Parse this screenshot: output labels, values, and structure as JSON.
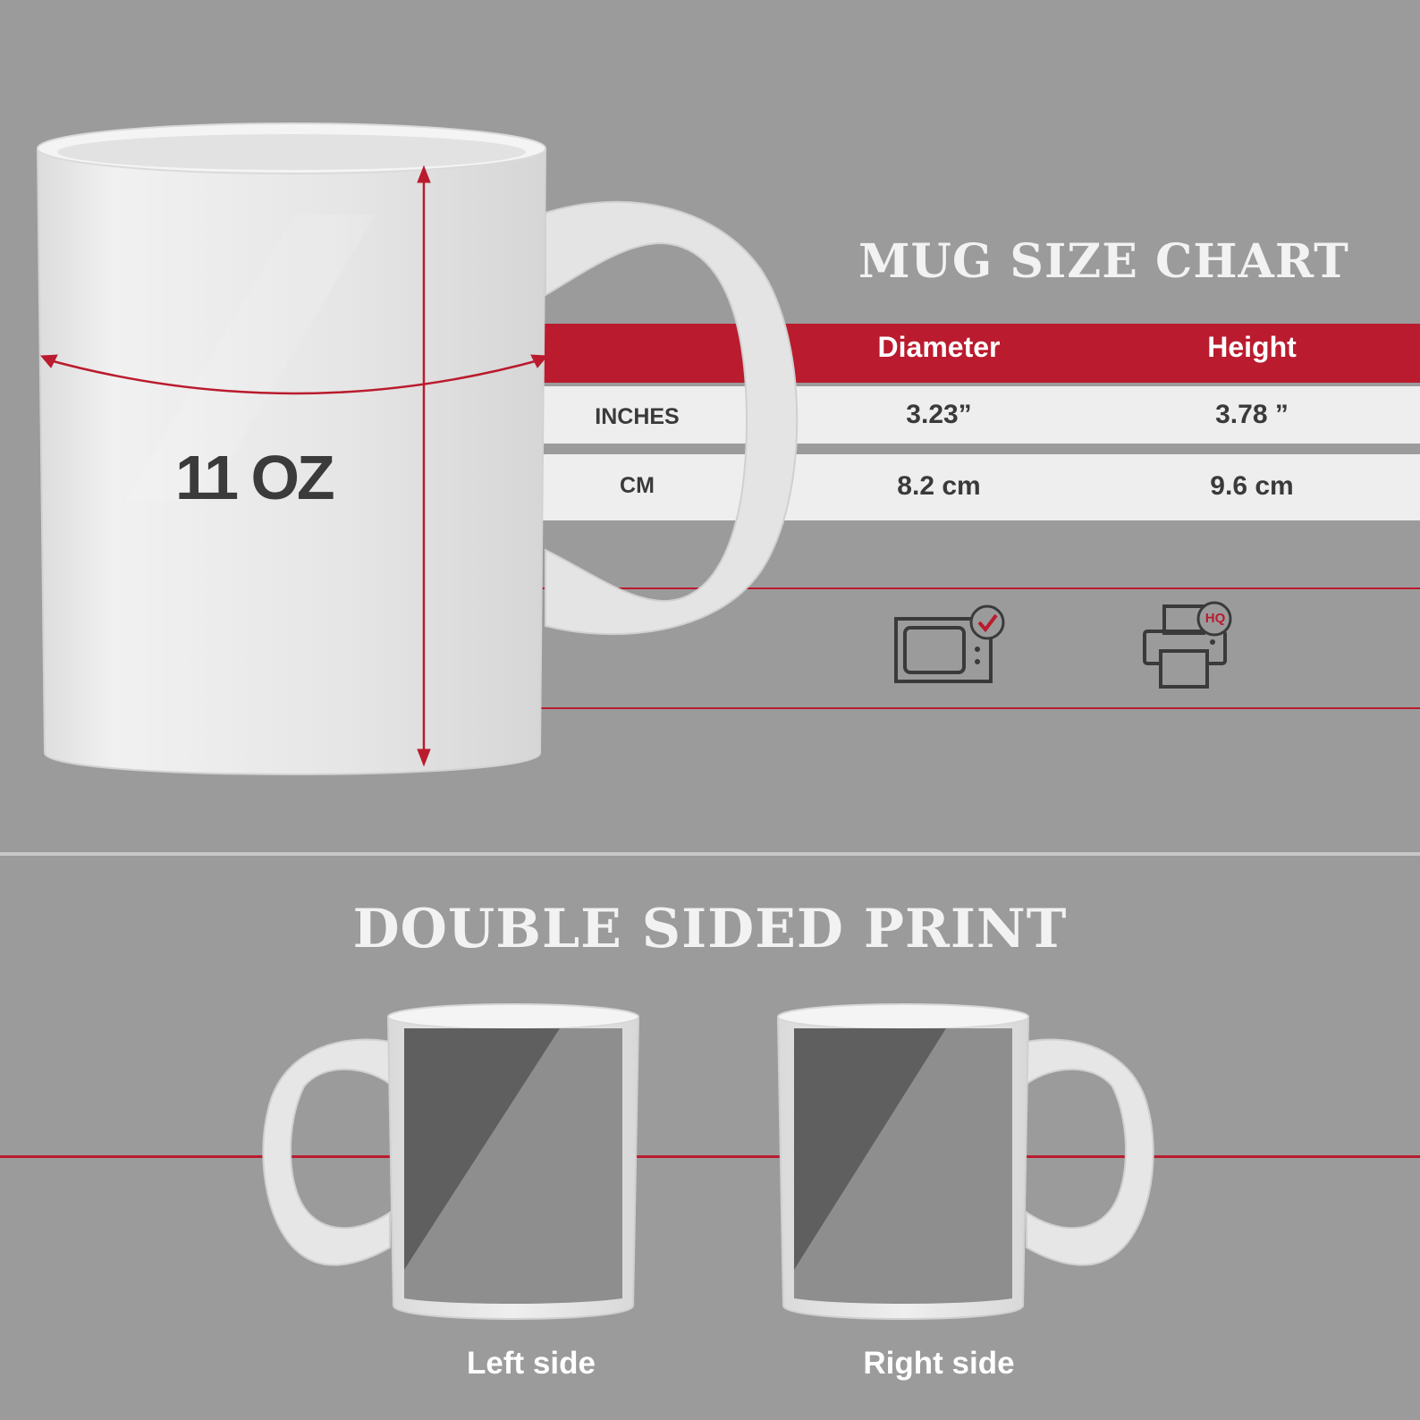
{
  "size_chart": {
    "title": "MUG SIZE CHART",
    "columns": [
      "Diameter",
      "Height"
    ],
    "rows": [
      {
        "unit": "INCHES",
        "diameter": "3.23”",
        "height": "3.78 ”"
      },
      {
        "unit": "CM",
        "diameter": "8.2 cm",
        "height": "9.6 cm"
      }
    ]
  },
  "mug": {
    "capacity": "11 OZ"
  },
  "icons": {
    "microwave": "microwave-safe-icon",
    "printer": "hq-printer-icon",
    "printer_badge": "HQ"
  },
  "print_section": {
    "title": "DOUBLE SIDED PRINT",
    "left_label": "Left side",
    "right_label": "Right side"
  },
  "colors": {
    "background": "#9b9b9c",
    "accent_red": "#ba1b2e",
    "band_white": "#eeeeee",
    "mug_white": "#e9e9e9",
    "print_dark": "#5f5f5f",
    "print_light": "#8e8e8e"
  }
}
